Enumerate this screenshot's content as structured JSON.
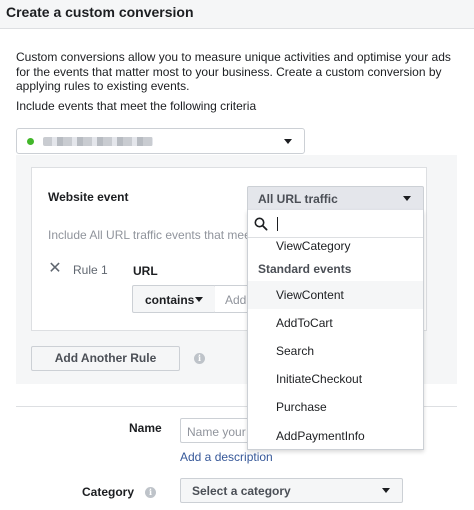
{
  "dialog": {
    "title": "Create a custom conversion"
  },
  "intro": {
    "description": "Custom conversions allow you to measure unique activities and optimise your ads for the events that matter most to your business. Create a custom conversion by applying rules to existing events.",
    "criteria_label": "Include events that meet the following criteria"
  },
  "rule_builder": {
    "website_event_label": "Website event",
    "include_text": "Include All URL traffic events that meet t",
    "rule_label": "Rule 1",
    "field_label": "URL",
    "operator_value": "contains",
    "value_placeholder": "Add",
    "add_rule_label": "Add Another Rule"
  },
  "event_dropdown": {
    "selected": "All URL traffic",
    "search_value": "",
    "items_top": [
      {
        "label": "ViewCategory"
      }
    ],
    "standard_heading": "Standard events",
    "standard_items": [
      {
        "label": "ViewContent",
        "highlighted": true
      },
      {
        "label": "AddToCart"
      },
      {
        "label": "Search"
      },
      {
        "label": "InitiateCheckout"
      },
      {
        "label": "Purchase"
      },
      {
        "label": "AddPaymentInfo"
      }
    ]
  },
  "form": {
    "name_label": "Name",
    "name_placeholder": "Name your c",
    "description_link": "Add a description",
    "category_label": "Category",
    "category_value": "Select a category"
  },
  "icons": {
    "status_dot": "green-status-dot",
    "info": "info-icon",
    "close": "close-icon",
    "search": "search-icon",
    "caret": "caret-down-icon"
  },
  "colors": {
    "link": "#365899",
    "status": "#42b72a"
  }
}
